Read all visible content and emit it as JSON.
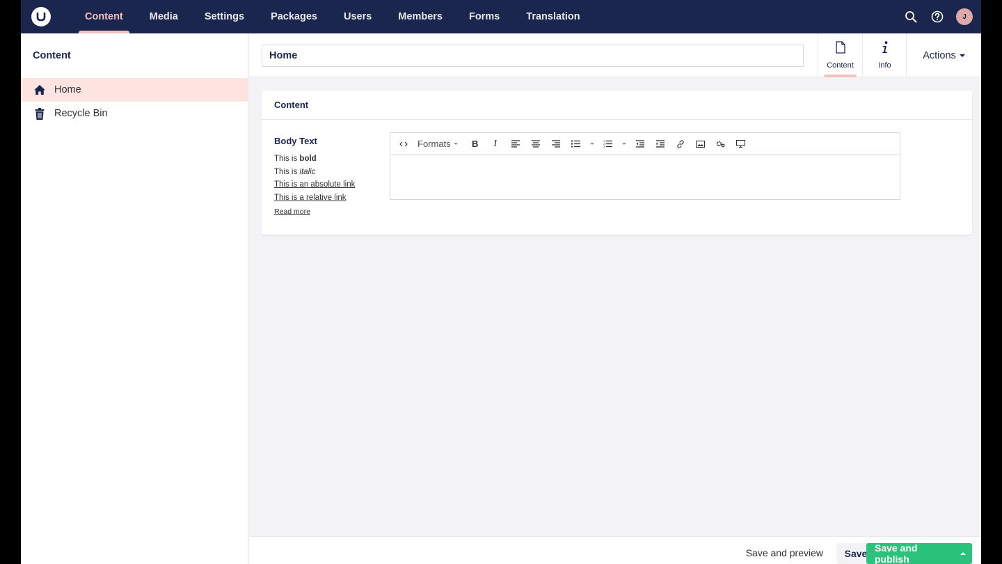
{
  "topnav": {
    "items": [
      "Content",
      "Media",
      "Settings",
      "Packages",
      "Users",
      "Members",
      "Forms",
      "Translation"
    ],
    "active_index": 0,
    "avatar_initial": "J",
    "icons": [
      "search-icon",
      "help-icon",
      "avatar"
    ]
  },
  "tree": {
    "header": "Content",
    "items": [
      {
        "label": "Home",
        "icon": "home-icon",
        "selected": true
      },
      {
        "label": "Recycle Bin",
        "icon": "trash-icon",
        "selected": false
      }
    ]
  },
  "editor": {
    "name_value": "Home",
    "tabs": [
      {
        "label": "Content",
        "icon": "document-icon",
        "active": true
      },
      {
        "label": "Info",
        "icon": "info-icon",
        "active": false
      }
    ],
    "actions_label": "Actions"
  },
  "box": {
    "header": "Content",
    "property_label": "Body Text",
    "description": {
      "line1_prefix": "This is ",
      "line1_bold": "bold",
      "line2_prefix": "This is ",
      "line2_italic": "italic",
      "absolute_link": "This is an absolute link",
      "relative_link": "This is a relative link"
    },
    "read_more": "Read more",
    "toolbar": {
      "formats_label": "Formats",
      "bold_label": "B",
      "italic_label": "I"
    }
  },
  "footer": {
    "preview_label": "Save and preview",
    "save_label": "Save",
    "publish_label": "Save and publish"
  },
  "colors": {
    "topbar": "#1b264f",
    "accent": "#f5c1bc",
    "selected_row": "#fde4e1",
    "publish": "#2bc37c"
  }
}
